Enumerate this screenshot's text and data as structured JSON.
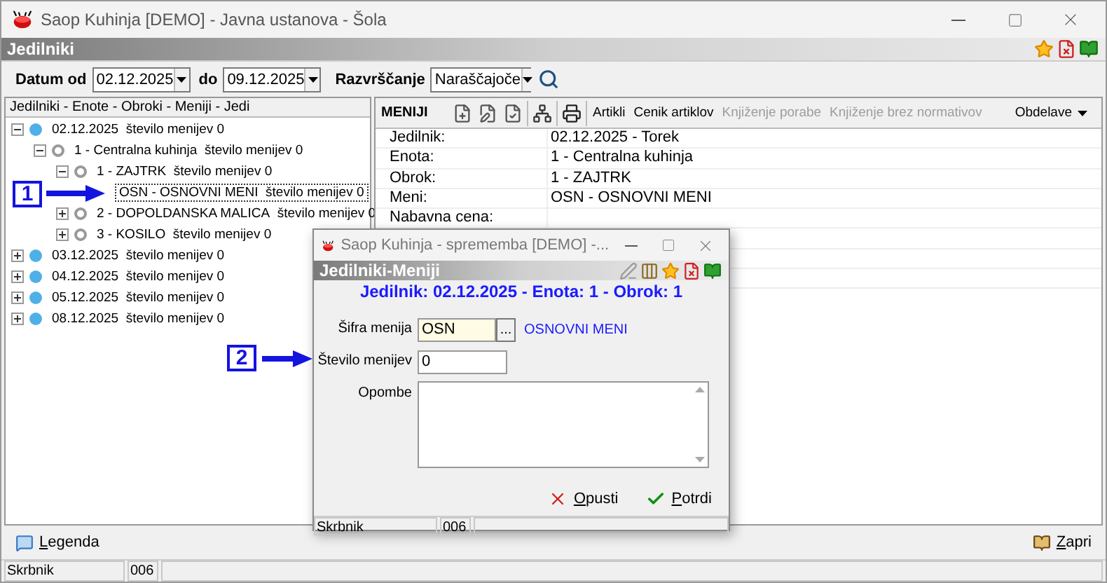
{
  "window": {
    "title": "Saop Kuhinja  [DEMO] - Javna ustanova - Šola"
  },
  "header": {
    "title": "Jedilniki"
  },
  "filter": {
    "date_from_label": "Datum od",
    "date_from": "02.12.2025",
    "date_to_label": "do",
    "date_to": "09.12.2025",
    "sort_label": "Razvrščanje",
    "sort": "Naraščajoče"
  },
  "tree": {
    "heading": "Jedilniki - Enote - Obroki - Meniji - Jedi",
    "items": [
      {
        "kind": "date",
        "label": "02.12.2025",
        "count": "število menijev 0",
        "expanded": true,
        "selected": false,
        "children": [
          {
            "kind": "unit",
            "label": "1 - Centralna kuhinja",
            "count": "število menijev 0",
            "expanded": true,
            "selected": false,
            "children": [
              {
                "kind": "meal",
                "label": "1 - ZAJTRK",
                "count": "število menijev 0",
                "expanded": true,
                "selected": false,
                "children": [
                  {
                    "kind": "menu",
                    "label": "OSN - OSNOVNI MENI",
                    "count": "število menijev 0",
                    "selected": true
                  }
                ]
              },
              {
                "kind": "meal",
                "label": "2 - DOPOLDANSKA MALICA",
                "count": "število menijev 0",
                "expanded": false,
                "selected": false
              },
              {
                "kind": "meal",
                "label": "3 - KOSILO",
                "count": "število menijev 0",
                "expanded": false,
                "selected": false
              }
            ]
          }
        ]
      },
      {
        "kind": "date",
        "label": "03.12.2025",
        "count": "število menijev 0",
        "expanded": false,
        "selected": false
      },
      {
        "kind": "date",
        "label": "04.12.2025",
        "count": "število menijev 0",
        "expanded": false,
        "selected": false
      },
      {
        "kind": "date",
        "label": "05.12.2025",
        "count": "število menijev 0",
        "expanded": false,
        "selected": false
      },
      {
        "kind": "date",
        "label": "08.12.2025",
        "count": "število menijev 0",
        "expanded": false,
        "selected": false
      }
    ]
  },
  "menu_panel": {
    "title": "MENIJI",
    "buttons": [
      {
        "label": "Artikli",
        "disabled": false
      },
      {
        "label": "Cenik artiklov",
        "disabled": false
      },
      {
        "label": "Knjiženje porabe",
        "disabled": true
      },
      {
        "label": "Knjiženje brez normativov",
        "disabled": true
      }
    ],
    "dropdown": "Obdelave",
    "details": [
      {
        "label": "Jedilnik:",
        "value": "02.12.2025 - Torek"
      },
      {
        "label": "Enota:",
        "value": "1 - Centralna kuhinja"
      },
      {
        "label": "Obrok:",
        "value": "1 - ZAJTRK"
      },
      {
        "label": "Meni:",
        "value": "OSN - OSNOVNI MENI"
      },
      {
        "label": "Nabavna cena:"
      }
    ]
  },
  "bottom": {
    "legend_button": "Legenda",
    "close_button": "Zapri"
  },
  "status_bar": {
    "user": "Skrbnik",
    "code": "006"
  },
  "callouts": [
    {
      "number": "1"
    },
    {
      "number": "2"
    }
  ],
  "dialog": {
    "title": "Saop Kuhinja - sprememba [DEMO] -...",
    "header": "Jedilniki-Meniji",
    "subtitle": "Jedilnik: 02.12.2025 - Enota: 1 - Obrok: 1",
    "code_label": "Šifra menija",
    "code_value": "OSN",
    "browse": "...",
    "code_name": "OSNOVNI MENI",
    "count_label": "Število menijev",
    "count_value": "0",
    "notes_label": "Opombe",
    "cancel": "Opusti",
    "confirm": "Potrdi",
    "status_user": "Skrbnik",
    "status_code": "006"
  }
}
